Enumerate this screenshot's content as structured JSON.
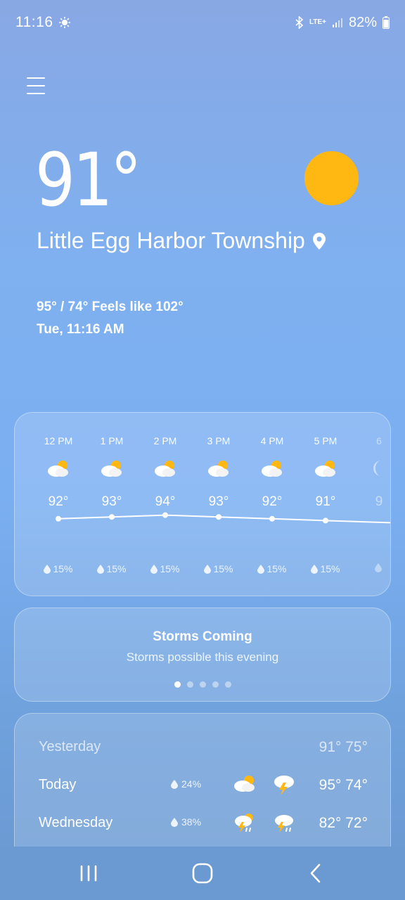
{
  "status": {
    "time": "11:16",
    "network": "LTE+",
    "battery": "82%"
  },
  "current": {
    "temp": "91°",
    "location": "Little Egg Harbor Township",
    "hi_lo_feels": "95° / 74° Feels like 102°",
    "datetime": "Tue, 11:16 AM",
    "sun_color": "#ffb712"
  },
  "hourly": [
    {
      "time": "12 PM",
      "temp": "92°",
      "precip": "15%",
      "icon": "partly-sunny-icon"
    },
    {
      "time": "1 PM",
      "temp": "93°",
      "precip": "15%",
      "icon": "partly-sunny-icon"
    },
    {
      "time": "2 PM",
      "temp": "94°",
      "precip": "15%",
      "icon": "partly-sunny-icon"
    },
    {
      "time": "3 PM",
      "temp": "93°",
      "precip": "15%",
      "icon": "partly-sunny-icon"
    },
    {
      "time": "4 PM",
      "temp": "92°",
      "precip": "15%",
      "icon": "partly-sunny-icon"
    },
    {
      "time": "5 PM",
      "temp": "91°",
      "precip": "15%",
      "icon": "partly-sunny-icon"
    },
    {
      "time": "6",
      "temp": "9",
      "precip": "",
      "icon": "moon-icon"
    }
  ],
  "storms": {
    "title": "Storms Coming",
    "subtitle": "Storms possible this evening",
    "pages": 5,
    "active_page": 0
  },
  "daily": [
    {
      "day": "Yesterday",
      "precip": "",
      "temps": "91° 75°",
      "icon_day": "",
      "icon_night": "",
      "muted": true
    },
    {
      "day": "Today",
      "precip": "24%",
      "temps": "95° 74°",
      "icon_day": "partly-sunny-icon",
      "icon_night": "thunderstorm-icon",
      "muted": false
    },
    {
      "day": "Wednesday",
      "precip": "38%",
      "temps": "82° 72°",
      "icon_day": "sun-thunder-rain-icon",
      "icon_night": "thunder-rain-icon",
      "muted": false
    }
  ]
}
